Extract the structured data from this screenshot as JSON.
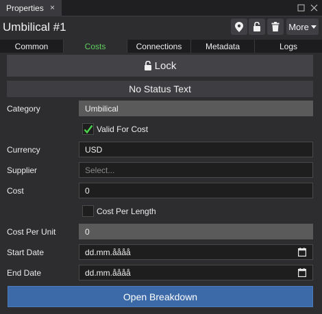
{
  "dock": {
    "tab_label": "Properties",
    "close_glyph": "×"
  },
  "header": {
    "title": "Umbilical #1",
    "buttons": [
      "pin-icon",
      "unlock-icon",
      "trash-icon"
    ],
    "more_label": "More"
  },
  "tabs": [
    {
      "label": "Common",
      "active": false
    },
    {
      "label": "Costs",
      "active": true
    },
    {
      "label": "Connections",
      "active": false
    },
    {
      "label": "Metadata",
      "active": false
    },
    {
      "label": "Logs",
      "active": false
    }
  ],
  "lock_label": "Lock",
  "status_text": "No Status Text",
  "form": {
    "category": {
      "label": "Category",
      "value": "Umbilical"
    },
    "valid_for_cost": {
      "label": "Valid For Cost",
      "checked": true
    },
    "currency": {
      "label": "Currency",
      "value": "USD"
    },
    "supplier": {
      "label": "Supplier",
      "placeholder": "Select..."
    },
    "cost": {
      "label": "Cost",
      "value": "0"
    },
    "cost_per_length": {
      "label": "Cost Per Length",
      "checked": false
    },
    "cost_per_unit": {
      "label": "Cost Per Unit",
      "value": "0"
    },
    "start_date": {
      "label": "Start Date",
      "value": "dd.mm.åååå"
    },
    "end_date": {
      "label": "End Date",
      "value": "dd.mm.åååå"
    }
  },
  "breakdown_label": "Open Breakdown",
  "colors": {
    "active_tab": "#5fd05f",
    "checkmark": "#4cd44c",
    "primary_button": "#3c6aa8"
  }
}
